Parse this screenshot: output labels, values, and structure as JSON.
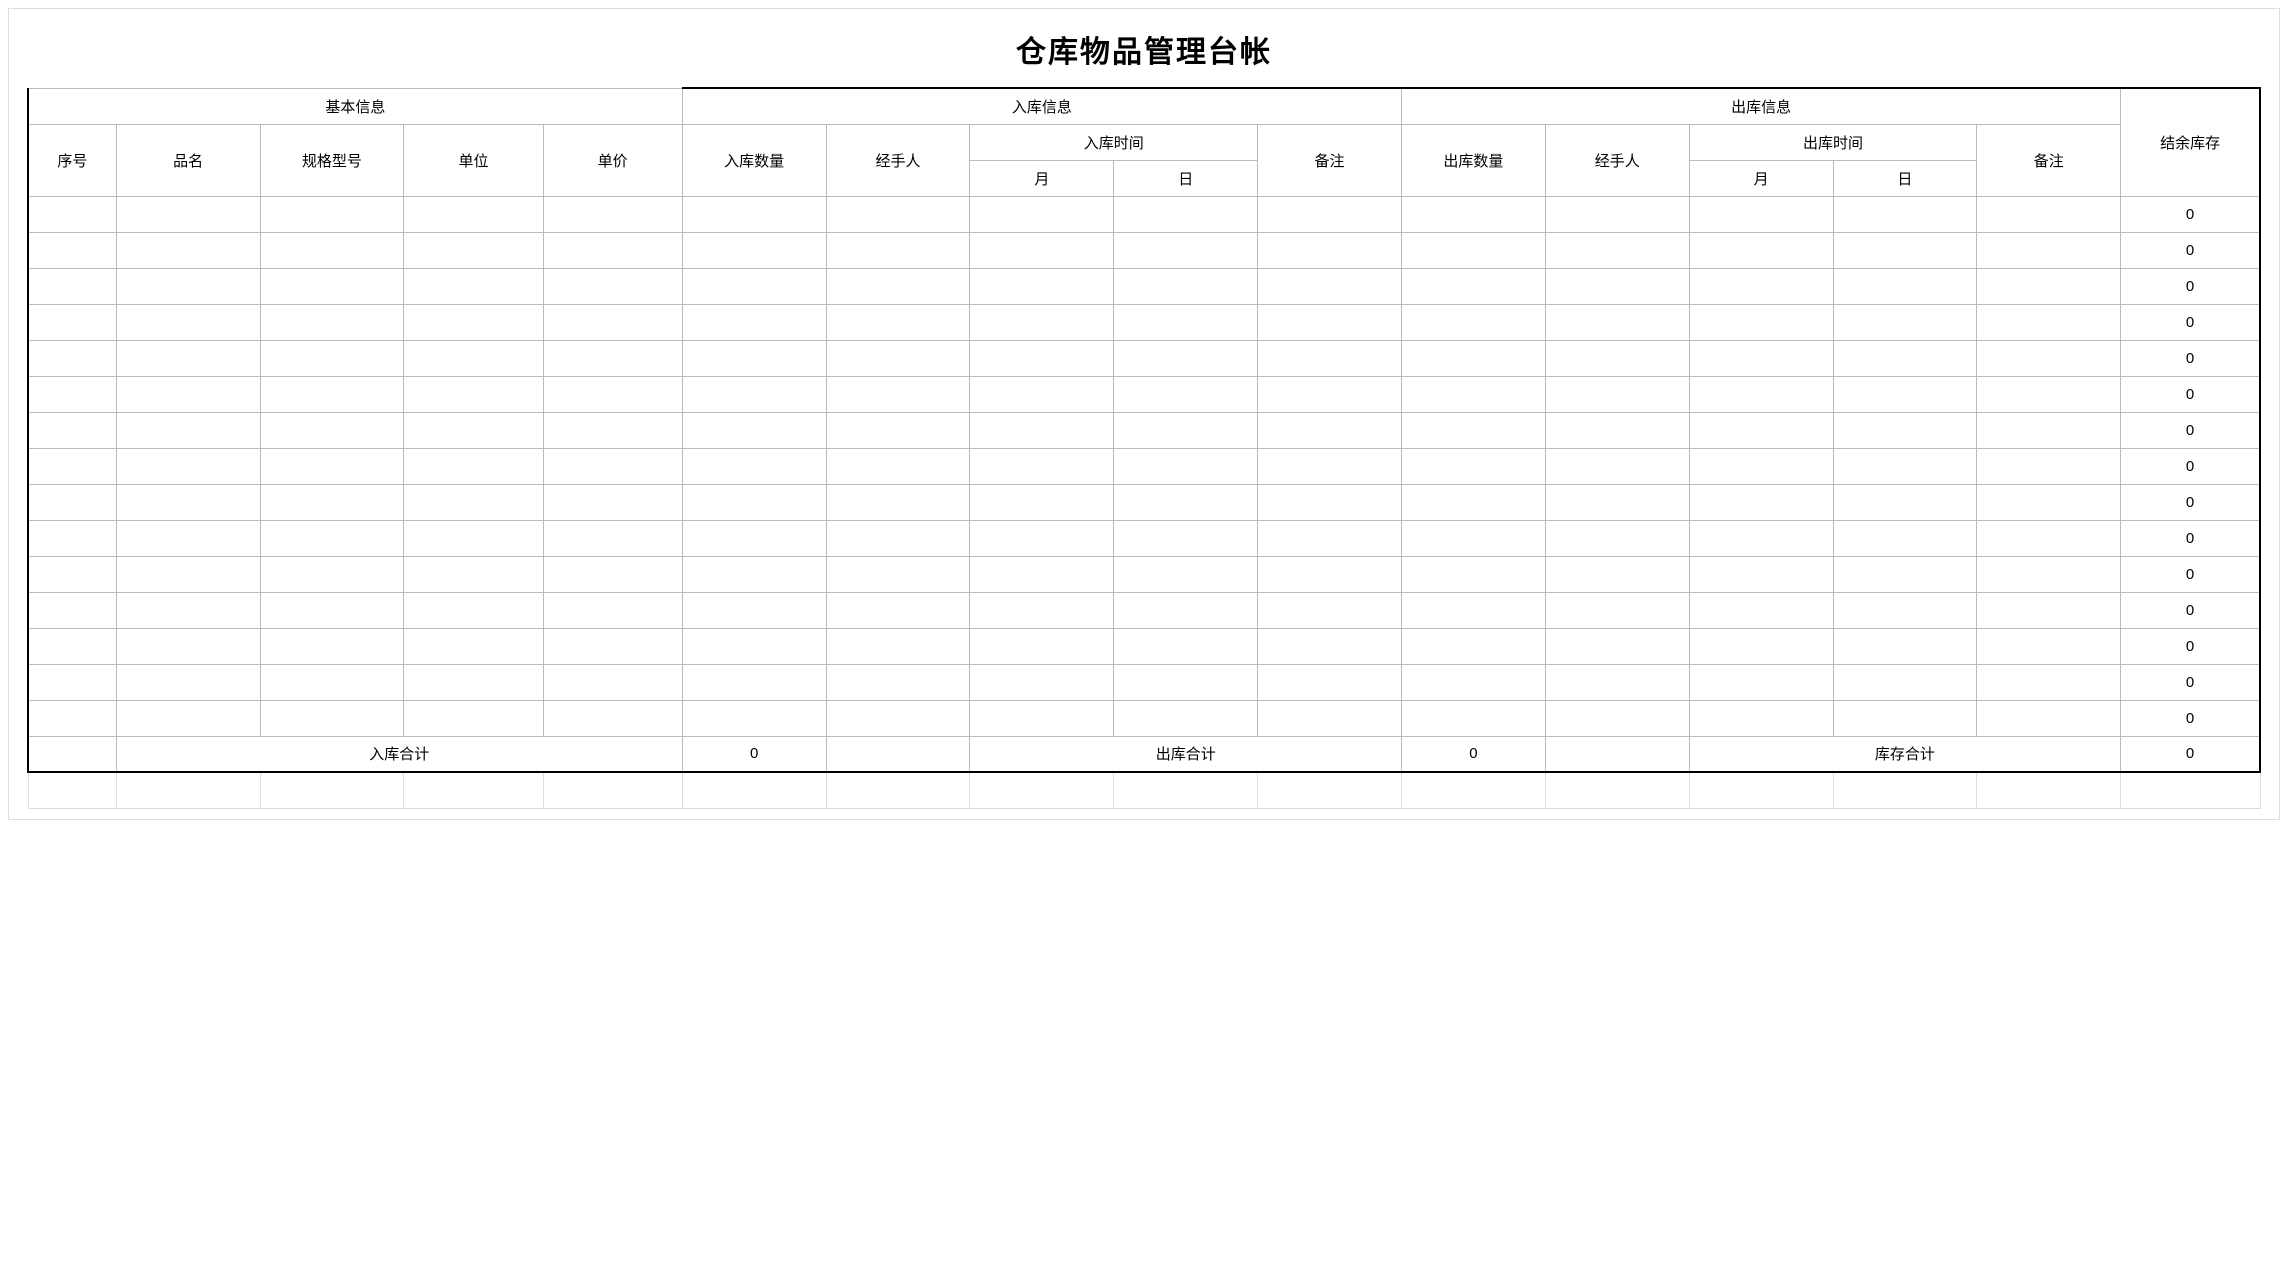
{
  "title": "仓库物品管理台帐",
  "header": {
    "group_basic": "基本信息",
    "group_in": "入库信息",
    "group_out": "出库信息",
    "seq": "序号",
    "name": "品名",
    "spec": "规格型号",
    "unit": "单位",
    "price": "单价",
    "in_qty": "入库数量",
    "in_operator": "经手人",
    "in_time": "入库时间",
    "month": "月",
    "day": "日",
    "note": "备注",
    "out_qty": "出库数量",
    "out_operator": "经手人",
    "out_time": "出库时间",
    "balance": "结余库存"
  },
  "rows": [
    {
      "seq": "",
      "name": "",
      "spec": "",
      "unit": "",
      "price": "",
      "in_qty": "",
      "in_op": "",
      "in_m": "",
      "in_d": "",
      "in_note": "",
      "out_qty": "",
      "out_op": "",
      "out_m": "",
      "out_d": "",
      "out_note": "",
      "balance": "0"
    },
    {
      "seq": "",
      "name": "",
      "spec": "",
      "unit": "",
      "price": "",
      "in_qty": "",
      "in_op": "",
      "in_m": "",
      "in_d": "",
      "in_note": "",
      "out_qty": "",
      "out_op": "",
      "out_m": "",
      "out_d": "",
      "out_note": "",
      "balance": "0"
    },
    {
      "seq": "",
      "name": "",
      "spec": "",
      "unit": "",
      "price": "",
      "in_qty": "",
      "in_op": "",
      "in_m": "",
      "in_d": "",
      "in_note": "",
      "out_qty": "",
      "out_op": "",
      "out_m": "",
      "out_d": "",
      "out_note": "",
      "balance": "0"
    },
    {
      "seq": "",
      "name": "",
      "spec": "",
      "unit": "",
      "price": "",
      "in_qty": "",
      "in_op": "",
      "in_m": "",
      "in_d": "",
      "in_note": "",
      "out_qty": "",
      "out_op": "",
      "out_m": "",
      "out_d": "",
      "out_note": "",
      "balance": "0"
    },
    {
      "seq": "",
      "name": "",
      "spec": "",
      "unit": "",
      "price": "",
      "in_qty": "",
      "in_op": "",
      "in_m": "",
      "in_d": "",
      "in_note": "",
      "out_qty": "",
      "out_op": "",
      "out_m": "",
      "out_d": "",
      "out_note": "",
      "balance": "0"
    },
    {
      "seq": "",
      "name": "",
      "spec": "",
      "unit": "",
      "price": "",
      "in_qty": "",
      "in_op": "",
      "in_m": "",
      "in_d": "",
      "in_note": "",
      "out_qty": "",
      "out_op": "",
      "out_m": "",
      "out_d": "",
      "out_note": "",
      "balance": "0"
    },
    {
      "seq": "",
      "name": "",
      "spec": "",
      "unit": "",
      "price": "",
      "in_qty": "",
      "in_op": "",
      "in_m": "",
      "in_d": "",
      "in_note": "",
      "out_qty": "",
      "out_op": "",
      "out_m": "",
      "out_d": "",
      "out_note": "",
      "balance": "0"
    },
    {
      "seq": "",
      "name": "",
      "spec": "",
      "unit": "",
      "price": "",
      "in_qty": "",
      "in_op": "",
      "in_m": "",
      "in_d": "",
      "in_note": "",
      "out_qty": "",
      "out_op": "",
      "out_m": "",
      "out_d": "",
      "out_note": "",
      "balance": "0"
    },
    {
      "seq": "",
      "name": "",
      "spec": "",
      "unit": "",
      "price": "",
      "in_qty": "",
      "in_op": "",
      "in_m": "",
      "in_d": "",
      "in_note": "",
      "out_qty": "",
      "out_op": "",
      "out_m": "",
      "out_d": "",
      "out_note": "",
      "balance": "0"
    },
    {
      "seq": "",
      "name": "",
      "spec": "",
      "unit": "",
      "price": "",
      "in_qty": "",
      "in_op": "",
      "in_m": "",
      "in_d": "",
      "in_note": "",
      "out_qty": "",
      "out_op": "",
      "out_m": "",
      "out_d": "",
      "out_note": "",
      "balance": "0"
    },
    {
      "seq": "",
      "name": "",
      "spec": "",
      "unit": "",
      "price": "",
      "in_qty": "",
      "in_op": "",
      "in_m": "",
      "in_d": "",
      "in_note": "",
      "out_qty": "",
      "out_op": "",
      "out_m": "",
      "out_d": "",
      "out_note": "",
      "balance": "0"
    },
    {
      "seq": "",
      "name": "",
      "spec": "",
      "unit": "",
      "price": "",
      "in_qty": "",
      "in_op": "",
      "in_m": "",
      "in_d": "",
      "in_note": "",
      "out_qty": "",
      "out_op": "",
      "out_m": "",
      "out_d": "",
      "out_note": "",
      "balance": "0"
    },
    {
      "seq": "",
      "name": "",
      "spec": "",
      "unit": "",
      "price": "",
      "in_qty": "",
      "in_op": "",
      "in_m": "",
      "in_d": "",
      "in_note": "",
      "out_qty": "",
      "out_op": "",
      "out_m": "",
      "out_d": "",
      "out_note": "",
      "balance": "0"
    },
    {
      "seq": "",
      "name": "",
      "spec": "",
      "unit": "",
      "price": "",
      "in_qty": "",
      "in_op": "",
      "in_m": "",
      "in_d": "",
      "in_note": "",
      "out_qty": "",
      "out_op": "",
      "out_m": "",
      "out_d": "",
      "out_note": "",
      "balance": "0"
    },
    {
      "seq": "",
      "name": "",
      "spec": "",
      "unit": "",
      "price": "",
      "in_qty": "",
      "in_op": "",
      "in_m": "",
      "in_d": "",
      "in_note": "",
      "out_qty": "",
      "out_op": "",
      "out_m": "",
      "out_d": "",
      "out_note": "",
      "balance": "0"
    }
  ],
  "totals": {
    "in_label": "入库合计",
    "in_value": "0",
    "out_label": "出库合计",
    "out_value": "0",
    "stock_label": "库存合计",
    "stock_value": "0"
  }
}
